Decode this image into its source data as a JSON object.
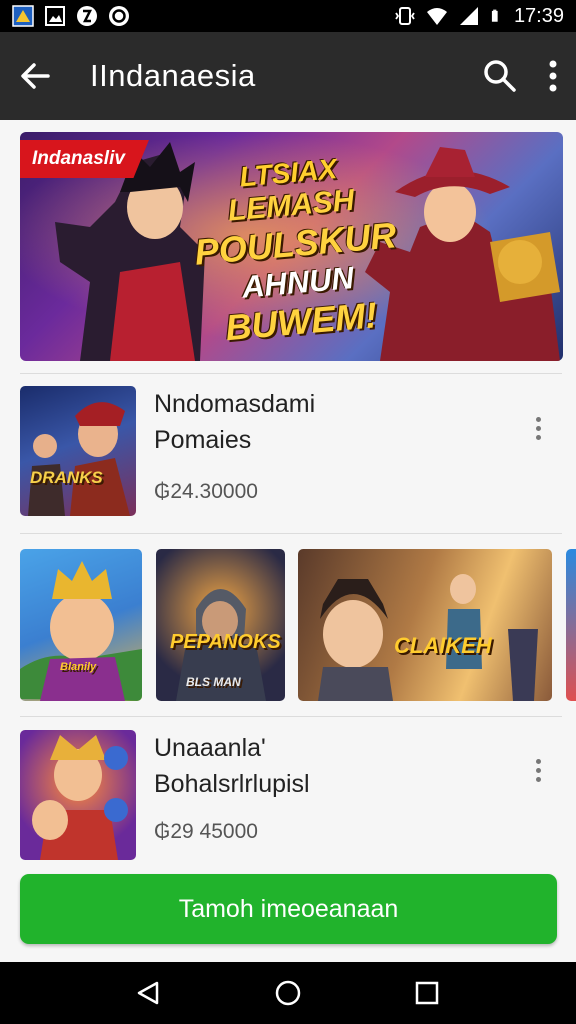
{
  "status_bar": {
    "time": "17:39",
    "icons": [
      "app-notification-icon",
      "image-notification-icon",
      "vpn-icon",
      "sync-icon",
      "vibrate-icon",
      "wifi-icon",
      "signal-icon",
      "battery-icon"
    ]
  },
  "app_bar": {
    "title": "IIndanaesia",
    "back_icon": "arrow-left-icon",
    "search_icon": "search-icon",
    "menu_icon": "more-vertical-icon"
  },
  "banner": {
    "tag": "Indanasliv",
    "lines": [
      "LTSIAX",
      "LEMASH",
      "POULSKUR",
      "AHNUN",
      "BUWEM!"
    ]
  },
  "items": [
    {
      "title_line1": "Nndomasdami",
      "title_line2": "Pomaies",
      "price": "₲24.30000",
      "thumb_label": "DRANKS"
    },
    {
      "title_line1": "Unaaanla'",
      "title_line2": "Bohalsrlrlupisl",
      "price": "₲29 45000",
      "thumb_label": ""
    }
  ],
  "carousel": [
    {
      "label": "Blanily"
    },
    {
      "label": "PEPANOKS",
      "sublabel": "BLS MAN"
    },
    {
      "label": "CLAIKEH"
    },
    {
      "label": ""
    }
  ],
  "cta": {
    "label": "Tamoh imeoeanaan"
  },
  "nav_bar": {
    "icons": [
      "back-triangle-icon",
      "home-circle-icon",
      "recents-square-icon"
    ]
  },
  "colors": {
    "cta": "#21b32c",
    "app_bar": "#2b2b2b",
    "tag": "#d8151c"
  }
}
